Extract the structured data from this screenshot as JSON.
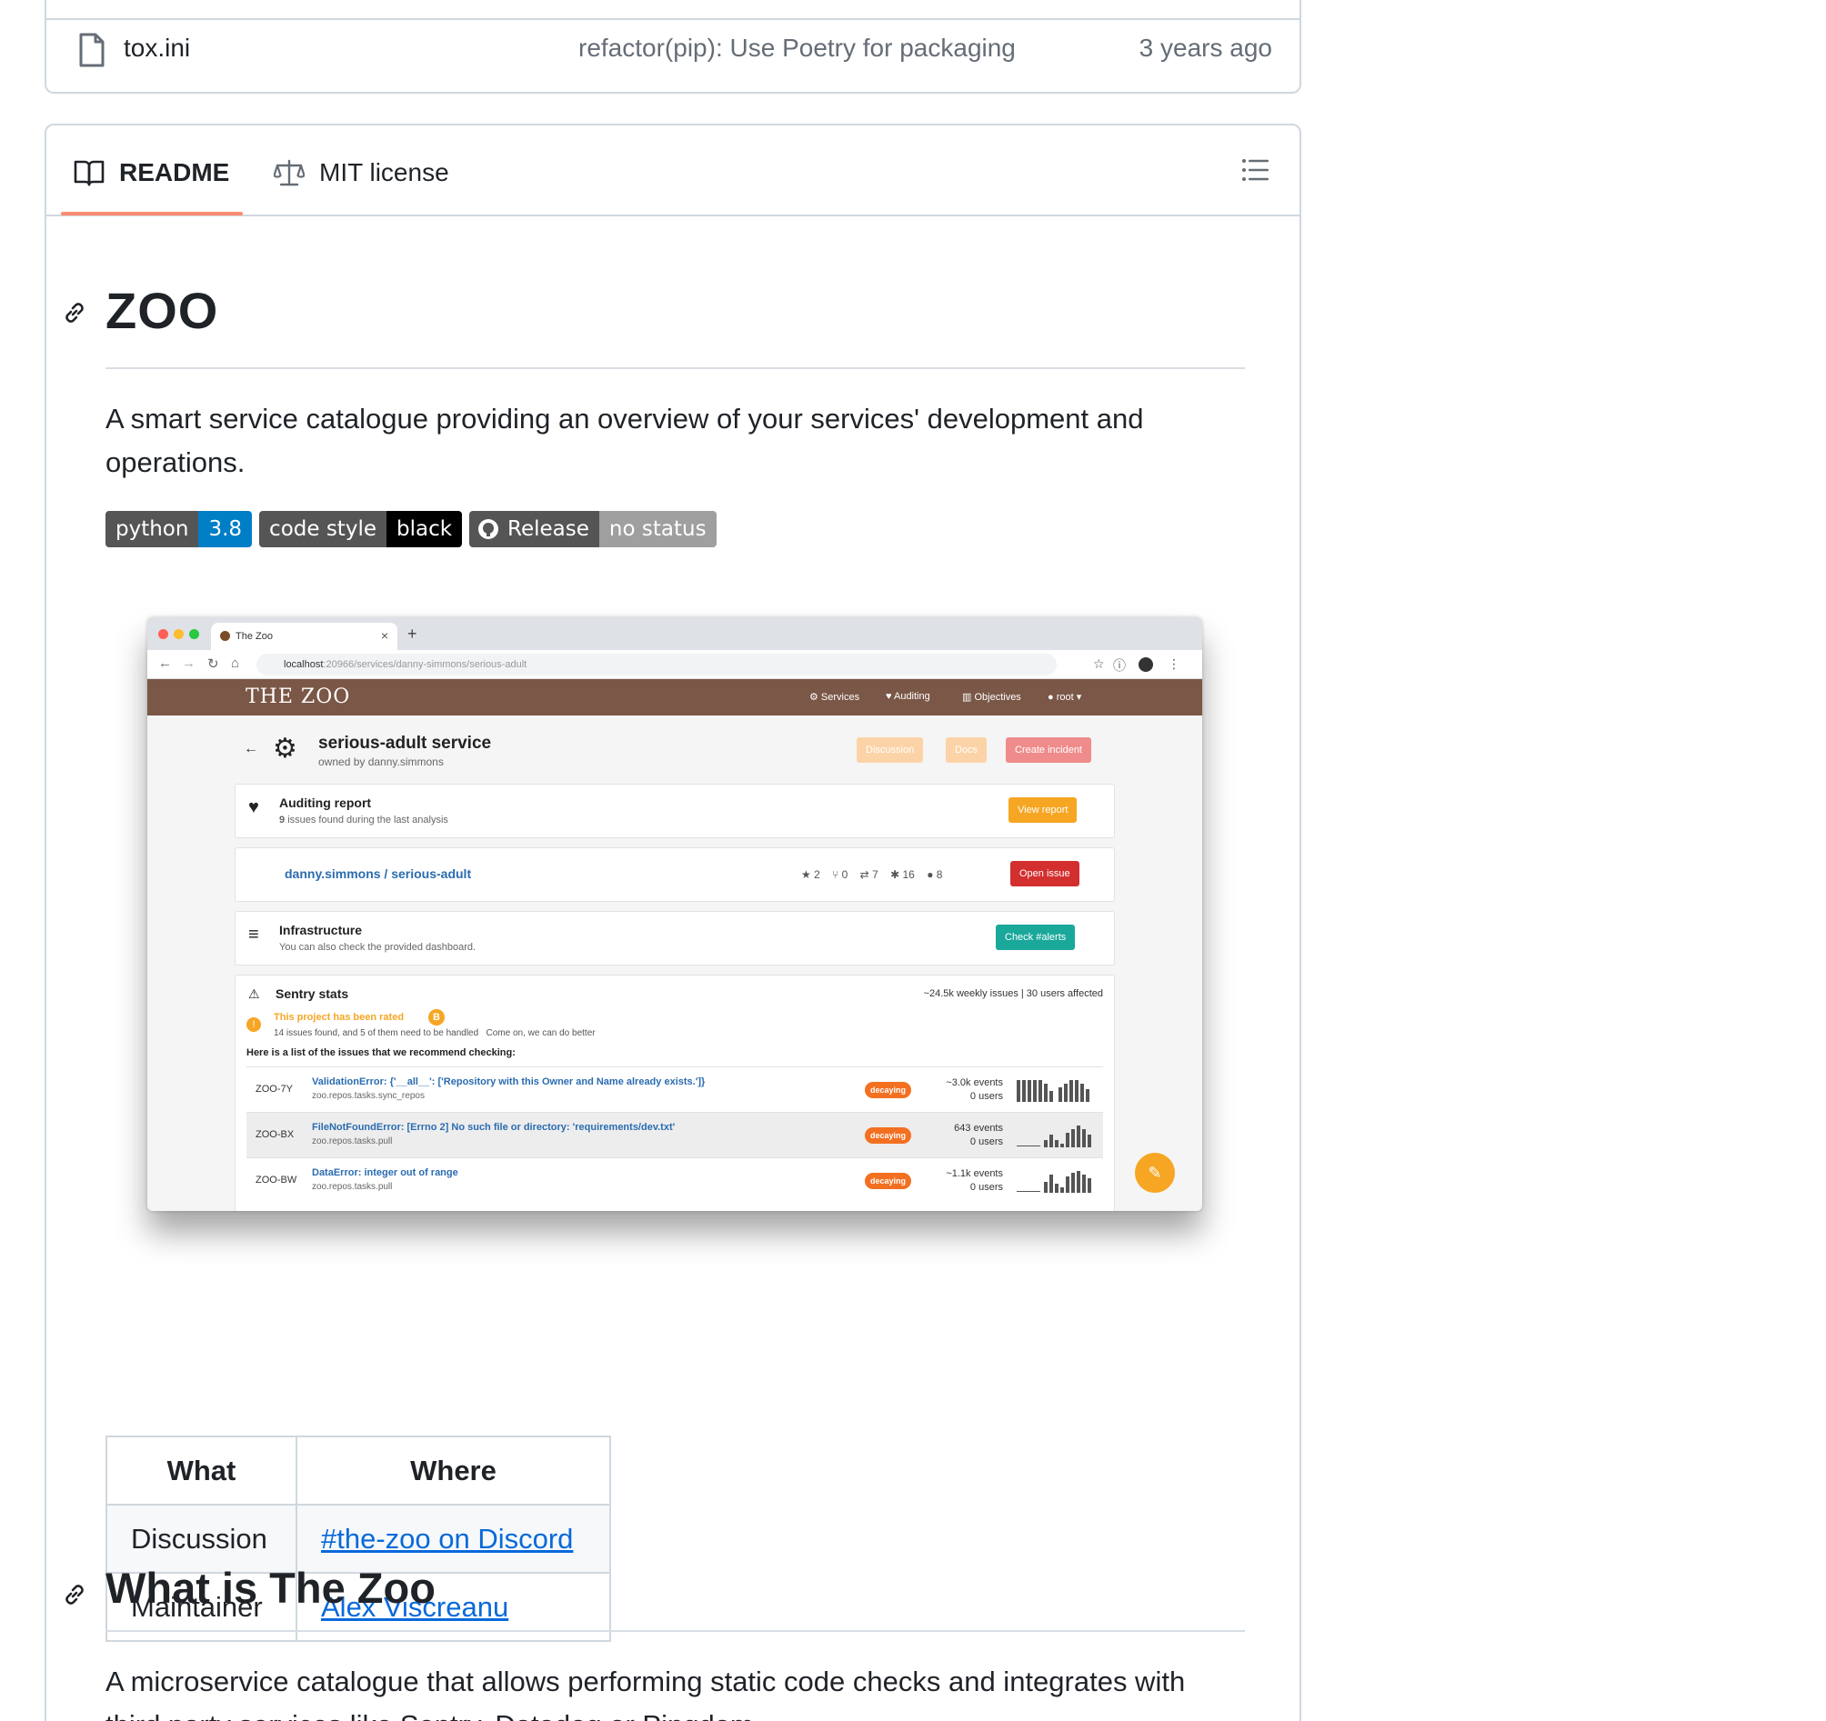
{
  "file_row": {
    "name": "tox.ini",
    "commit_message": "refactor(pip): Use Poetry for packaging",
    "time": "3 years ago"
  },
  "readme_tabs": {
    "readme": "README",
    "license": "MIT license"
  },
  "readme": {
    "title": "ZOO",
    "description": "A smart service catalogue providing an overview of your services' development and operations.",
    "badges": [
      {
        "left": "python",
        "right": "3.8",
        "right_color": "#007ec6"
      },
      {
        "left": "code style",
        "right": "black",
        "right_color": "#000000"
      },
      {
        "left": "Release",
        "right": "no status",
        "right_color": "#9f9f9f",
        "icon": "github-icon"
      }
    ],
    "table": {
      "headers": [
        "What",
        "Where"
      ],
      "rows": [
        {
          "what": "Discussion",
          "where": "#the-zoo on Discord"
        },
        {
          "what": "Maintainer",
          "where": "Alex Viscreanu"
        }
      ]
    },
    "section_title": "What is The Zoo",
    "section_text": "A microservice catalogue that allows performing static code checks and integrates with third party services like Sentry, Datadog or Pingdom."
  },
  "screenshot": {
    "tab_title": "The Zoo",
    "url_host": "localhost",
    "url_path": ":20966/services/danny-simmons/serious-adult",
    "logo": "THE ZOO",
    "menu": [
      "Services",
      "Auditing",
      "Objectives",
      "root"
    ],
    "service_title": "serious-adult service",
    "owner": "owned by danny.simmons",
    "buttons": [
      "Discussion",
      "Docs",
      "Create incident"
    ],
    "auditing": {
      "title": "Auditing report",
      "count": "9",
      "subtitle": "issues found during the last analysis",
      "button": "View report"
    },
    "repo": {
      "link": "danny.simmons / serious-adult",
      "stars": "2",
      "forks": "0",
      "prs": "7",
      "bugs": "16",
      "users": "8",
      "button": "Open issue"
    },
    "infra": {
      "title": "Infrastructure",
      "subtitle": "You can also check the provided dashboard.",
      "button": "Check #alerts"
    },
    "sentry": {
      "title": "Sentry stats",
      "summary": "~24.5k weekly issues | 30 users affected",
      "rated": "This project has been rated",
      "rating": "B",
      "found": "14 issues found, and 5 of them need to be handled",
      "encourage": "Come on, we can do better",
      "list_intro": "Here is a list of the issues that we recommend checking:",
      "issues": [
        {
          "id": "ZOO-7Y",
          "error": "ValidationError: {'__all__': ['Repository with this Owner and Name already exists.']}",
          "module": "zoo.repos.tasks.sync_repos",
          "tag": "decaying",
          "events": "~3.0k events",
          "users": "0 users"
        },
        {
          "id": "ZOO-BX",
          "error": "FileNotFoundError: [Errno 2] No such file or directory: 'requirements/dev.txt'",
          "module": "zoo.repos.tasks.pull",
          "tag": "decaying",
          "events": "643 events",
          "users": "0 users"
        },
        {
          "id": "ZOO-BW",
          "error": "DataError: integer out of range",
          "module": "zoo.repos.tasks.pull",
          "tag": "decaying",
          "events": "~1.1k events",
          "users": "0 users"
        }
      ]
    }
  }
}
